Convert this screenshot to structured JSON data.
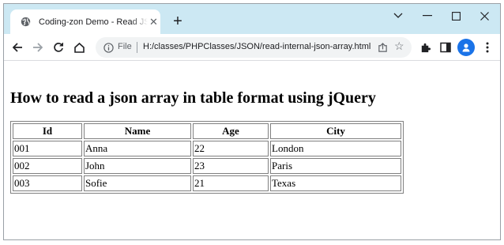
{
  "browser": {
    "tab_title": "Coding-zon Demo - Read JSON Arra",
    "new_tab": "+",
    "address": {
      "file_label": "File",
      "url": "H:/classes/PHPClasses/JSON/read-internal-json-array.html"
    }
  },
  "page": {
    "heading": "How to read a json array in table format using jQuery",
    "table": {
      "headers": [
        "Id",
        "Name",
        "Age",
        "City"
      ],
      "rows": [
        [
          "001",
          "Anna",
          "22",
          "London"
        ],
        [
          "002",
          "John",
          "23",
          "Paris"
        ],
        [
          "003",
          "Sofie",
          "21",
          "Texas"
        ]
      ]
    }
  }
}
